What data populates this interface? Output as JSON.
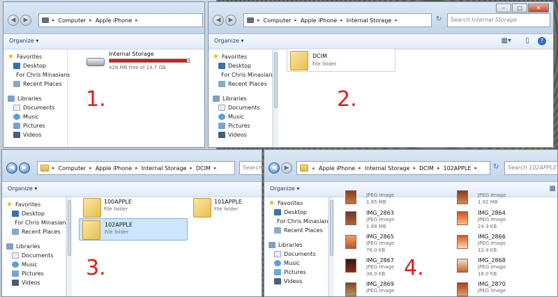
{
  "common": {
    "organize": "Organize ▾",
    "favorites": "Favorites",
    "desktop": "Desktop",
    "for_chris": "For Chris Minasians",
    "recent": "Recent Places",
    "libraries": "Libraries",
    "documents": "Documents",
    "music": "Music",
    "pictures": "Pictures",
    "videos": "Videos"
  },
  "win1": {
    "crumbs": [
      "Computer",
      "Apple iPhone"
    ],
    "device_name": "Internal Storage",
    "device_free": "428 MB free of 14.7 GB",
    "used_fraction": 0.97,
    "step": "1."
  },
  "win2": {
    "crumbs": [
      "Computer",
      "Apple iPhone",
      "Internal Storage"
    ],
    "search": "Search Internal Storage",
    "folder_name": "DCIM",
    "folder_type": "File folder",
    "step": "2."
  },
  "win3": {
    "crumbs": [
      "Computer",
      "Apple iPhone",
      "Internal Storage",
      "DCIM"
    ],
    "search": "Search DC",
    "folders": [
      {
        "name": "100APPLE",
        "type": "File folder"
      },
      {
        "name": "101APPLE",
        "type": "File folder"
      },
      {
        "name": "102APPLE",
        "type": "File folder"
      }
    ],
    "step": "3."
  },
  "win4": {
    "crumbs": [
      "«",
      "Apple iPhone",
      "Internal Storage",
      "DCIM",
      "102APPLE"
    ],
    "search": "Search 102APPLE",
    "files_left": [
      {
        "name": "",
        "type": "JPEG Image",
        "size": "1.85 MB"
      },
      {
        "name": "IMG_2863",
        "type": "JPEG Image",
        "size": "1.88 MB"
      },
      {
        "name": "IMG_2865",
        "type": "JPEG Image",
        "size": "76.0 KB"
      },
      {
        "name": "IMG_2867",
        "type": "JPEG Image",
        "size": "38.0 KB"
      },
      {
        "name": "IMG_2869",
        "type": "JPEG Image",
        "size": ""
      }
    ],
    "files_right": [
      {
        "name": "",
        "type": "JPEG Image",
        "size": "1.92 MB"
      },
      {
        "name": "IMG_2864",
        "type": "JPEG Image",
        "size": "24.3 KB"
      },
      {
        "name": "IMG_2866",
        "type": "JPEG Image",
        "size": "12.4 KB"
      },
      {
        "name": "IMG_2868",
        "type": "JPEG Image",
        "size": "18.0 KB"
      },
      {
        "name": "IMG_2870",
        "type": "JPEG Image",
        "size": ""
      }
    ],
    "step": "4."
  },
  "colors": {
    "capacity_bar": "#d7191c",
    "step_number": "#e01a1a",
    "selection": "#cde6fb"
  },
  "icons": [
    "back-arrow-icon",
    "forward-arrow-icon",
    "folder-icon",
    "star-icon",
    "drive-icon",
    "search-icon",
    "refresh-icon"
  ]
}
